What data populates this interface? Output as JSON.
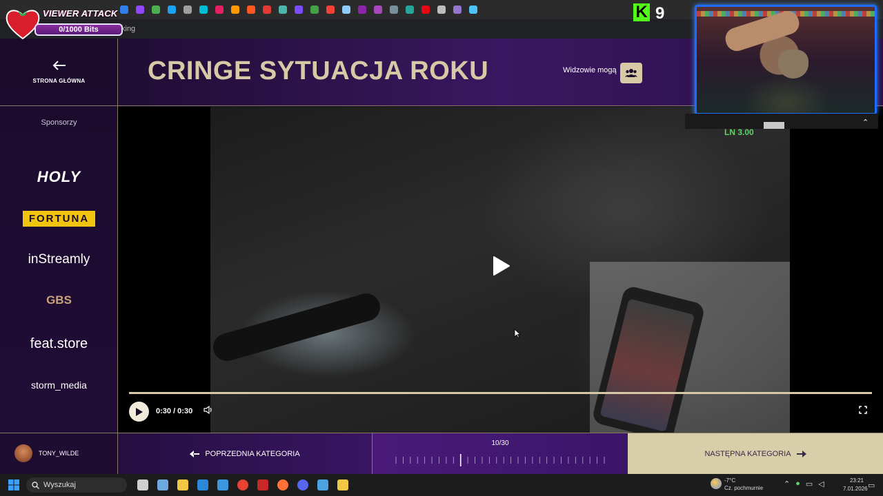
{
  "overlay": {
    "viewer_attack": {
      "title": "VIEWER ATTACK",
      "bits": "0/1000 Bits"
    },
    "kick_logo": "K",
    "counter": "9",
    "odds_label": "LN 3.00"
  },
  "browser": {
    "tab_fragment": "king"
  },
  "nav": {
    "home_label": "STRONA GŁÓWNA"
  },
  "header": {
    "title": "CRINGE SYTUACJA ROKU",
    "viewers_label": "Widzowie mogą"
  },
  "sidebar": {
    "sponsors_heading": "Sponsorzy",
    "sponsors": [
      "HOLY",
      "FORTUNA",
      "inStreamly",
      "GBS",
      "feat.store",
      "storm_media"
    ]
  },
  "video": {
    "time": "0:30 / 0:30",
    "progress": 1.0
  },
  "bottom": {
    "username": "TONY_WILDE",
    "prev_label": "POPRZEDNIA KATEGORIA",
    "next_label": "NASTĘPNA KATEGORIA",
    "page_counter": "10/30",
    "current_page": 10,
    "total_pages": 30
  },
  "taskbar": {
    "search_placeholder": "Wyszukaj",
    "weather_temp": "-7°C",
    "weather_desc": "Cz. pochmurnie",
    "time": "23:21",
    "date": "7.01.2026"
  },
  "colors": {
    "accent_gold": "#d7c9a6",
    "purple": "#3a1760",
    "cam_border": "#1e6bff",
    "odds_green": "#5fd36a"
  }
}
